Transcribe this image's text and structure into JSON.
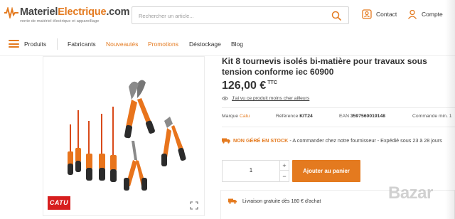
{
  "header": {
    "logo": {
      "name_part1": "Materiel",
      "name_part2": "Electrique",
      "name_part3": ".com",
      "tagline": "vente de matériel électrique et appareillage"
    },
    "search": {
      "placeholder": "Rechercher un article...",
      "icon": "search-icon"
    },
    "contact_label": "Contact",
    "account_label": "Compte",
    "accent_color": "#e47a1f"
  },
  "nav": {
    "menu_label": "Produits",
    "items": [
      {
        "label": "Fabricants"
      },
      {
        "label": "Nouveautés"
      },
      {
        "label": "Promotions"
      },
      {
        "label": "Déstockage"
      },
      {
        "label": "Blog"
      }
    ]
  },
  "gallery": {
    "brand_logo": "CATU",
    "expand_icon": "expand-icon"
  },
  "product": {
    "title": "Kit 8 tournevis isolés bi-matière pour travaux sous tension conforme iec 60900",
    "price": "126,00 €",
    "price_suffix": "TTC",
    "cheaper_link": "J'ai vu ce produit moins cher ailleurs",
    "brand_label": "Marque",
    "brand_value": "Catu",
    "ref_label": "Référence",
    "ref_value": "KIT24",
    "ean_label": "EAN",
    "ean_value": "3597560019148",
    "min_order_label": "Commande min. 1",
    "stock_tag": "NON GÉRÉ EN STOCK",
    "stock_text": " - A commander chez notre fournisseur - Expédié sous 23 à 28 jours",
    "quantity": "1",
    "add_to_cart": "Ajouter au panier",
    "delivery_text": "Livraison gratuite dès 180 € d'achat"
  },
  "watermark": "Bazar"
}
